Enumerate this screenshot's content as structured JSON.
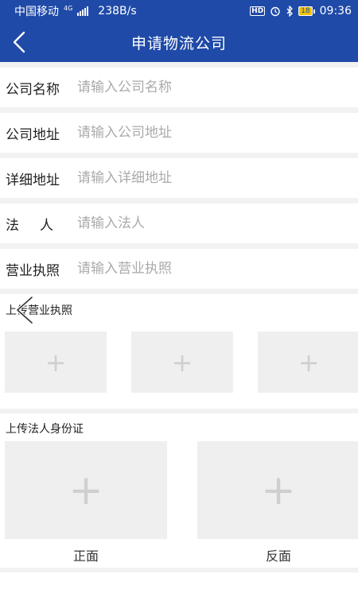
{
  "status": {
    "carrier": "中国移动",
    "net": "4G",
    "speed": "238B/s",
    "hd": "HD",
    "battery": "18",
    "time": "09:36"
  },
  "header": {
    "title": "申请物流公司"
  },
  "form": {
    "fields": [
      {
        "label": "公司名称",
        "placeholder": "请输入公司名称"
      },
      {
        "label": "公司地址",
        "placeholder": "请输入公司地址"
      },
      {
        "label": "详细地址",
        "placeholder": "请输入详细地址"
      },
      {
        "label": "法人",
        "placeholder": "请输入法人"
      },
      {
        "label": "营业执照",
        "placeholder": "请输入营业执照"
      }
    ]
  },
  "license_upload": {
    "title": "上传营业执照",
    "plus": "+"
  },
  "id_upload": {
    "title": "上传法人身份证",
    "front": "正面",
    "back": "反面",
    "plus": "+"
  }
}
